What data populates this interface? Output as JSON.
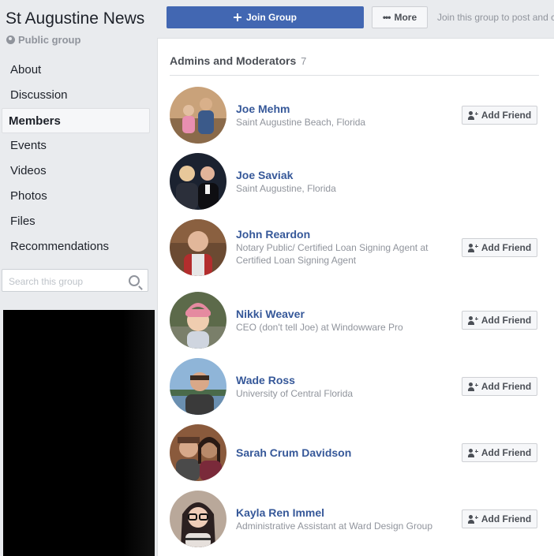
{
  "group": {
    "title": "St Augustine News",
    "privacy": "Public group"
  },
  "nav": {
    "items": [
      {
        "label": "About",
        "active": false
      },
      {
        "label": "Discussion",
        "active": false
      },
      {
        "label": "Members",
        "active": true
      },
      {
        "label": "Events",
        "active": false
      },
      {
        "label": "Videos",
        "active": false
      },
      {
        "label": "Photos",
        "active": false
      },
      {
        "label": "Files",
        "active": false
      },
      {
        "label": "Recommendations",
        "active": false
      }
    ]
  },
  "search": {
    "placeholder": "Search this group",
    "value": ""
  },
  "actions": {
    "join_label": "Join Group",
    "more_label": "More",
    "join_hint": "Join this group to post and comment."
  },
  "section": {
    "title": "Admins and Moderators",
    "count": "7"
  },
  "add_friend_label": "Add Friend",
  "members": [
    {
      "name": "Joe Mehm",
      "subtitle": "Saint Augustine Beach, Florida",
      "has_add_friend": true,
      "avatar_bg": "#c9a27a",
      "avatar_fg": "#3b5a8a"
    },
    {
      "name": "Joe Saviak",
      "subtitle": "Saint Augustine, Florida",
      "has_add_friend": false,
      "avatar_bg": "#1b2230",
      "avatar_fg": "#e2c9a8"
    },
    {
      "name": "John Reardon",
      "subtitle": "Notary Public/ Certified Loan Signing Agent at Certified Loan Signing Agent",
      "has_add_friend": true,
      "avatar_bg": "#6b4a32",
      "avatar_fg": "#b32d2d"
    },
    {
      "name": "Nikki Weaver",
      "subtitle": "CEO (don't tell Joe) at Windowware Pro",
      "has_add_friend": true,
      "avatar_bg": "#5c6a4a",
      "avatar_fg": "#e58aa0"
    },
    {
      "name": "Wade Ross",
      "subtitle": "University of Central Florida",
      "has_add_friend": true,
      "avatar_bg": "#8fb5d8",
      "avatar_fg": "#3a2a20"
    },
    {
      "name": "Sarah Crum Davidson",
      "subtitle": "",
      "has_add_friend": true,
      "avatar_bg": "#8a5a3c",
      "avatar_fg": "#2a1a14"
    },
    {
      "name": "Kayla Ren Immel",
      "subtitle": "Administrative Assistant at Ward Design Group",
      "has_add_friend": true,
      "avatar_bg": "#b9a89a",
      "avatar_fg": "#2b2020"
    }
  ]
}
